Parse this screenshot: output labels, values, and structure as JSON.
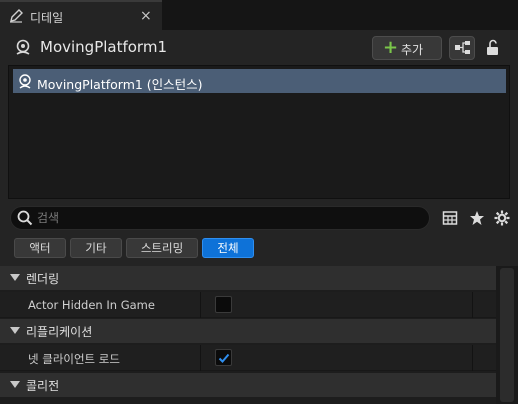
{
  "tab": {
    "label": "디테일",
    "close": "×"
  },
  "header": {
    "title": "MovingPlatform1",
    "add_label": "추가",
    "add_plus": "+"
  },
  "tree": {
    "items": [
      {
        "label": "MovingPlatform1 (인스턴스)"
      }
    ]
  },
  "search": {
    "placeholder": "검색",
    "value": ""
  },
  "filters": [
    {
      "label": "액터",
      "active": false
    },
    {
      "label": "기타",
      "active": false
    },
    {
      "label": "스트리밍",
      "active": false
    },
    {
      "label": "전체",
      "active": true
    }
  ],
  "sections": [
    {
      "label": "렌더링",
      "properties": [
        {
          "label": "Actor Hidden In Game",
          "checked": false
        }
      ]
    },
    {
      "label": "리플리케이션",
      "properties": [
        {
          "label": "넷 클라이언트 로드",
          "checked": true
        }
      ]
    },
    {
      "label": "콜리전",
      "properties": []
    }
  ],
  "colors": {
    "accent": "#0e72d8",
    "selection": "#4b5e76",
    "add_icon": "#7ac64a"
  }
}
